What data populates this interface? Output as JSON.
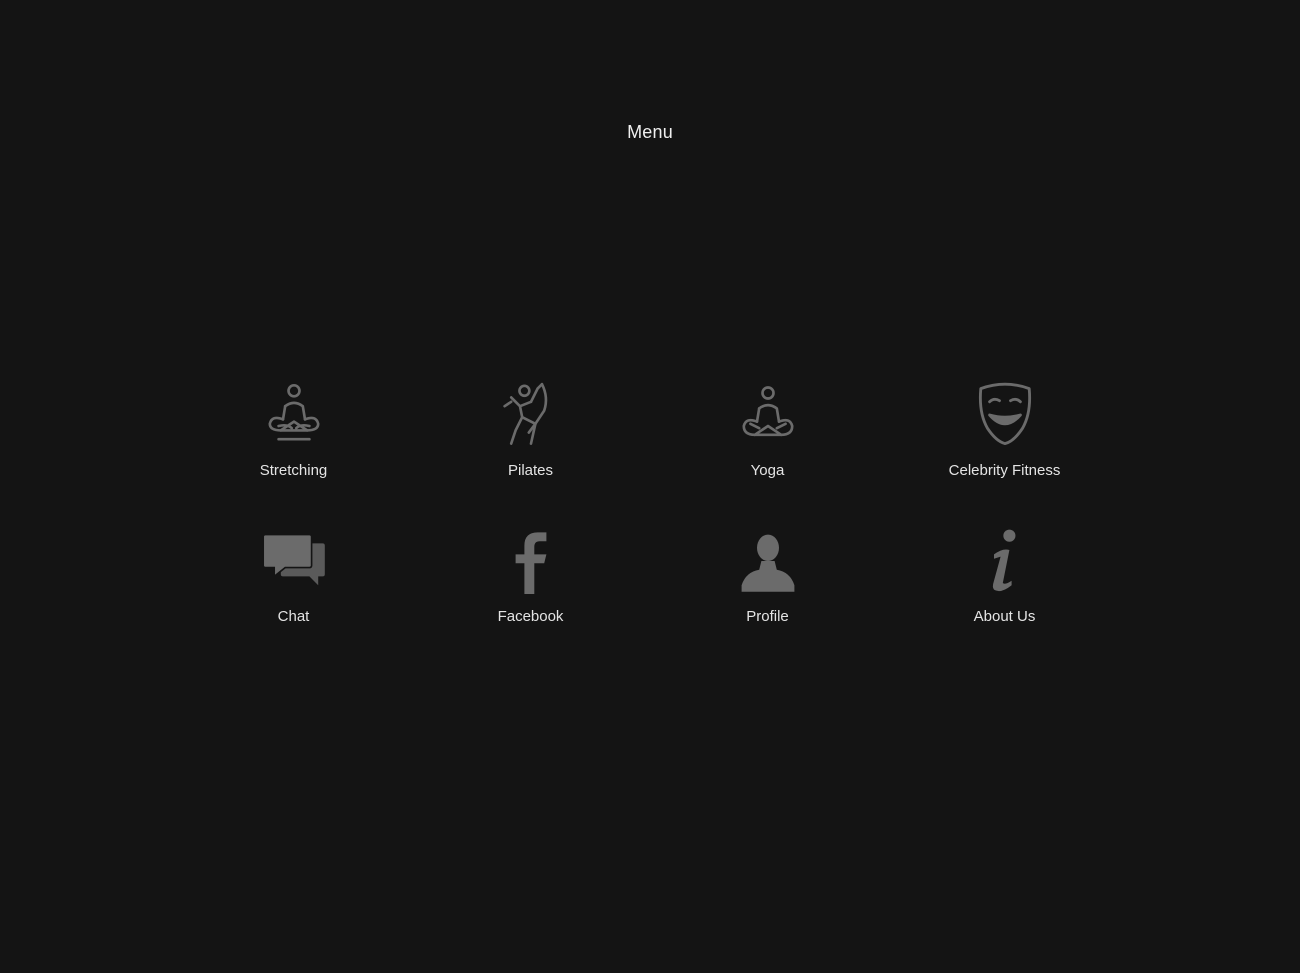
{
  "menu": {
    "title": "Menu",
    "items": [
      {
        "label": "Stretching",
        "icon": "meditation-stretch-icon"
      },
      {
        "label": "Pilates",
        "icon": "pilates-figure-icon"
      },
      {
        "label": "Yoga",
        "icon": "yoga-lotus-icon"
      },
      {
        "label": "Celebrity Fitness",
        "icon": "theatre-mask-icon"
      },
      {
        "label": "Chat",
        "icon": "chat-bubbles-icon"
      },
      {
        "label": "Facebook",
        "icon": "facebook-icon"
      },
      {
        "label": "Profile",
        "icon": "user-silhouette-icon"
      },
      {
        "label": "About Us",
        "icon": "info-icon"
      }
    ]
  },
  "colors": {
    "background": "#141414",
    "icon": "#6b6b6b",
    "text": "#e4e4e4"
  }
}
